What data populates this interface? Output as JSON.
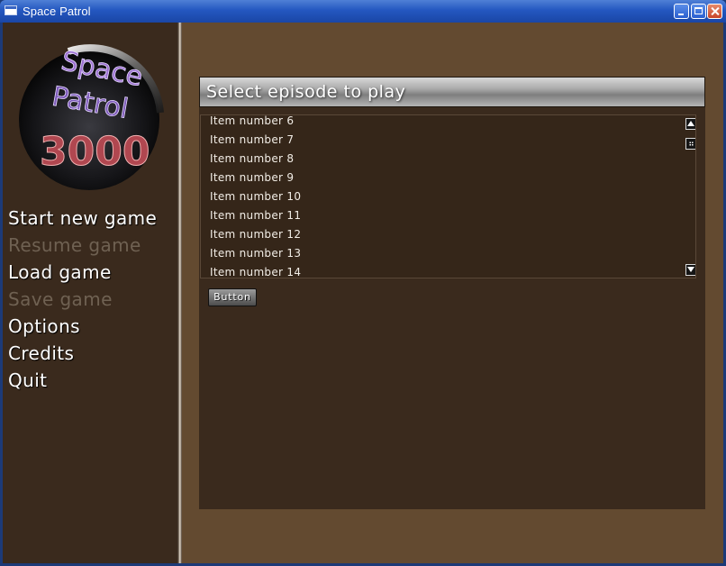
{
  "window": {
    "title": "Space Patrol",
    "controls": {
      "minimize_icon": "minimize-icon",
      "maximize_icon": "maximize-icon",
      "close_icon": "close-icon"
    }
  },
  "logo": {
    "lines": [
      "Space",
      "Patrol",
      "3000"
    ]
  },
  "menu": {
    "items": [
      {
        "label": "Start new game",
        "enabled": true
      },
      {
        "label": "Resume game",
        "enabled": false
      },
      {
        "label": "Load game",
        "enabled": true
      },
      {
        "label": "Save game",
        "enabled": false
      },
      {
        "label": "Options",
        "enabled": true
      },
      {
        "label": "Credits",
        "enabled": true
      },
      {
        "label": "Quit",
        "enabled": true
      }
    ]
  },
  "episode_panel": {
    "title": "Select episode to play",
    "list_items": [
      "Item number 6",
      "Item number 7",
      "Item number 8",
      "Item number 9",
      "Item number 10",
      "Item number 11",
      "Item number 12",
      "Item number 13",
      "Item number 14"
    ],
    "button_label": "Button"
  },
  "colors": {
    "background": "#634a30",
    "panel": "#3a2a1d",
    "disabled_text": "#6f6152"
  }
}
